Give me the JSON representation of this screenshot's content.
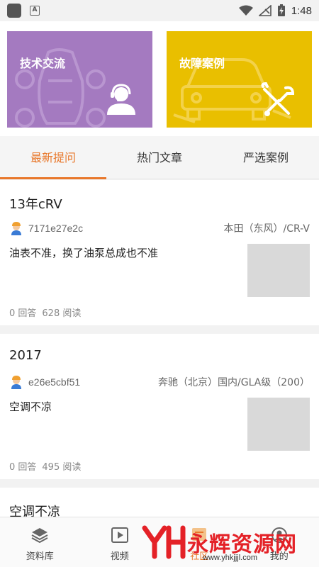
{
  "status_bar": {
    "time": "1:48"
  },
  "cards": [
    {
      "title": "技术交流"
    },
    {
      "title": "故障案例"
    }
  ],
  "tabs": [
    {
      "label": "最新提问",
      "active": true
    },
    {
      "label": "热门文章",
      "active": false
    },
    {
      "label": "严选案例",
      "active": false
    }
  ],
  "posts": [
    {
      "title": "13年cRV",
      "author": "7171e27e2c",
      "car_model": "本田（东风）/CR-V",
      "body": "油表不准，换了油泵总成也不准",
      "answers": "0 回答",
      "reads": "628 阅读"
    },
    {
      "title": "2017",
      "author": "e26e5cbf51",
      "car_model": "奔驰（北京）国内/GLA级（200）",
      "body": "空调不凉",
      "answers": "0 回答",
      "reads": "495 阅读"
    },
    {
      "title": "空调不凉"
    }
  ],
  "bottom_nav": [
    {
      "label": "资料库",
      "icon": "layers-icon"
    },
    {
      "label": "视频",
      "icon": "video-icon"
    },
    {
      "label": "社区",
      "icon": "community-icon"
    },
    {
      "label": "我的",
      "icon": "profile-icon"
    }
  ],
  "watermark": {
    "text": "永辉资源网",
    "url": "www.yhkjjjl.com"
  },
  "colors": {
    "accent": "#e8772a",
    "tech_card": "#a47ac0",
    "fault_card": "#e9bf00",
    "watermark": "#e42127"
  }
}
